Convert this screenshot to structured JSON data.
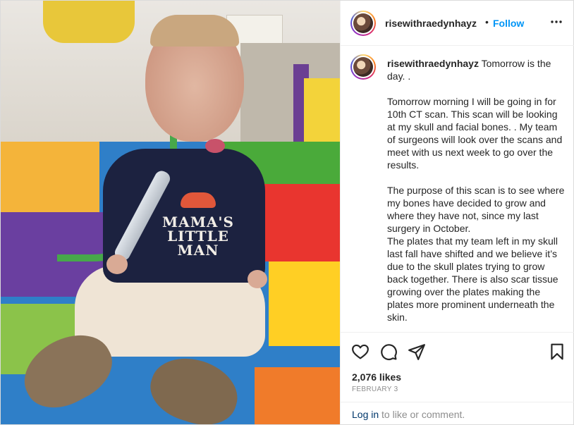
{
  "post": {
    "username": "risewithraedynhayz",
    "dot": "•",
    "follow_label": "Follow",
    "caption_paragraphs": [
      "Tomorrow is the day. .",
      "Tomorrow morning I will be going in for 10th CT scan. This scan will be looking at my skull and facial bones. . My team of surgeons will look over the scans and meet with us next week to go over the results.",
      "The purpose of this scan is to see where my bones have decided to grow and where they have not, since my last surgery in October.\nThe plates that my team left in my skull last fall have shifted and we believe it’s due to the skull plates trying to grow back together. There is also scar tissue growing over the plates making the plates more prominent underneath the skin."
    ],
    "likes": "2,076 likes",
    "date": "FEBRUARY 3",
    "login_link": "Log in",
    "login_rest": " to like or comment."
  },
  "photo": {
    "shirt_text": "MAMA'S LITTLE MAN"
  },
  "icons": {
    "more": "more-options-icon",
    "like": "heart-icon",
    "comment": "comment-icon",
    "share": "paper-plane-icon",
    "save": "bookmark-icon"
  },
  "colors": {
    "link_blue": "#0095f6",
    "text": "#262626",
    "muted": "#8e8e8e",
    "login_link": "#00376b"
  }
}
